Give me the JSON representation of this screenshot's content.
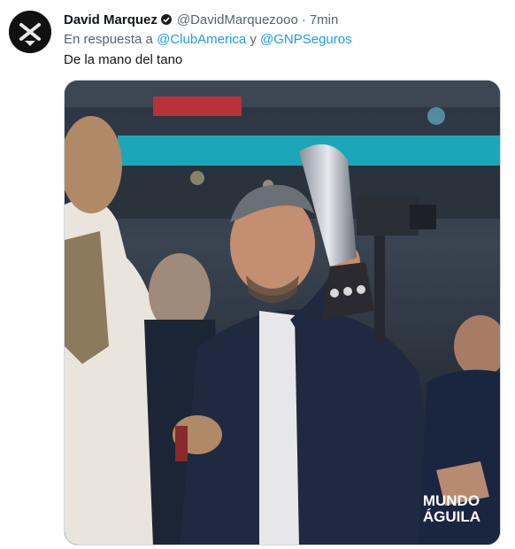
{
  "author": {
    "display_name": "David Marquez",
    "handle": "@DavidMarquezooo",
    "separator": "·",
    "time": "7min"
  },
  "reply": {
    "prefix": "En respuesta a ",
    "mention_1": "@ClubAmerica",
    "conjunction": " y ",
    "mention_2": "@GNPSeguros"
  },
  "tweet_text": "De la mano del tano",
  "image": {
    "watermark_line1": "MUNDO",
    "watermark_line2": "ÁGUILA"
  },
  "colors": {
    "link": "#1d9bf0",
    "secondary_text": "#536471",
    "primary_text": "#0f1419"
  }
}
